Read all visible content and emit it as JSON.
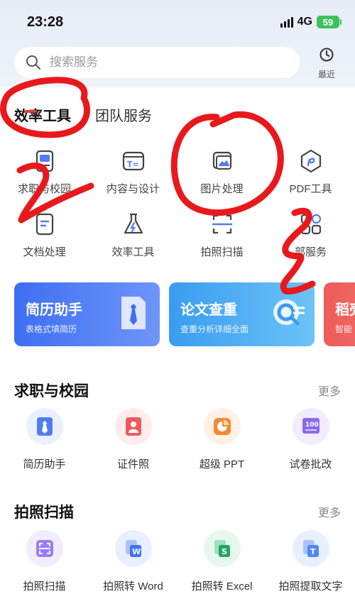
{
  "status_bar": {
    "time": "23:28",
    "network": "4G",
    "battery": "59"
  },
  "search": {
    "placeholder": "搜索服务",
    "recent_label": "最近"
  },
  "tabs": [
    {
      "label": "效率工具",
      "active": true
    },
    {
      "label": "团队服务",
      "active": false
    }
  ],
  "tools": [
    {
      "label": "求职与校园",
      "icon": "resume-icon"
    },
    {
      "label": "内容与设计",
      "icon": "text-format-icon"
    },
    {
      "label": "图片处理",
      "icon": "image-icon"
    },
    {
      "label": "PDF工具",
      "icon": "pdf-icon"
    },
    {
      "label": "文档处理",
      "icon": "document-icon"
    },
    {
      "label": "效率工具",
      "icon": "flask-icon"
    },
    {
      "label": "拍照扫描",
      "icon": "scan-icon"
    },
    {
      "label": "部服务",
      "icon": "grid-icon"
    }
  ],
  "banners": [
    {
      "title": "简历助手",
      "subtitle": "表格式填简历",
      "color": "#4f7cf6"
    },
    {
      "title": "论文查重",
      "subtitle": "查重分析详细全面",
      "color": "#45a6f2"
    },
    {
      "title": "稻壳",
      "subtitle": "智能",
      "color": "#f06a6a"
    }
  ],
  "sections": [
    {
      "title": "求职与校园",
      "more": "更多",
      "items": [
        {
          "label": "简历助手",
          "icon": "tie-icon"
        },
        {
          "label": "证件照",
          "icon": "id-photo-icon"
        },
        {
          "label": "超级 PPT",
          "icon": "ppt-icon"
        },
        {
          "label": "试卷批改",
          "icon": "exam-icon"
        }
      ]
    },
    {
      "title": "拍照扫描",
      "more": "更多",
      "items": [
        {
          "label": "拍照扫描",
          "icon": "scan-icon"
        },
        {
          "label": "拍照转 Word",
          "icon": "word-icon"
        },
        {
          "label": "拍照转 Excel",
          "icon": "excel-icon"
        },
        {
          "label": "拍照提取文字",
          "icon": "text-extract-icon"
        }
      ]
    }
  ],
  "annotation_color": "#e8191c"
}
